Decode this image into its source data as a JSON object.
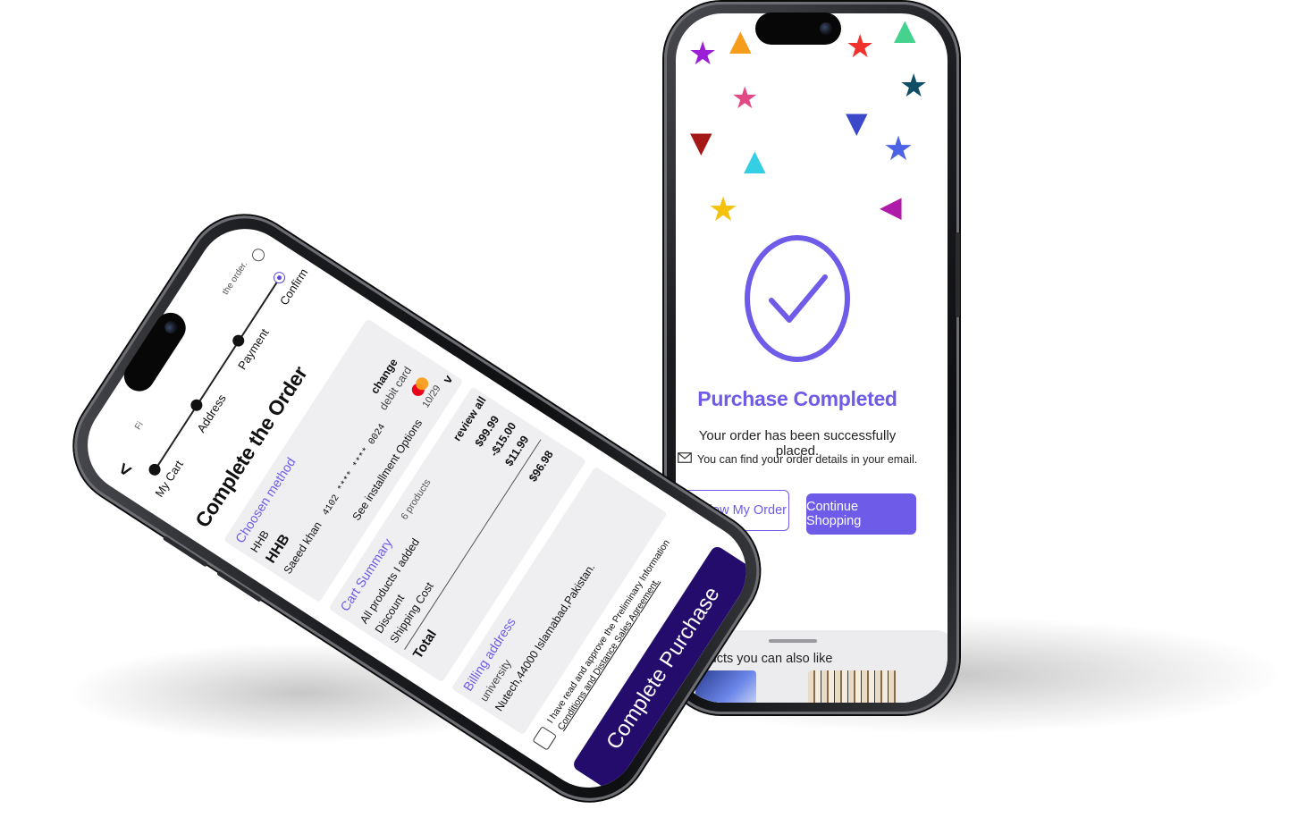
{
  "order_screen": {
    "back_icon": "chevron-left-icon",
    "hint_text": "Fi",
    "hint_text_end": "the order.",
    "steps": [
      "My Cart",
      "Address",
      "Payment",
      "Confirm"
    ],
    "title": "Complete the Order",
    "payment": {
      "section_title": "Choosen method",
      "bank_short": "HHB",
      "bank_name": "HHB",
      "change_label": "change",
      "card_type": "debit card",
      "holder": "Saeed khan",
      "card_number": "4102 **** **** 0024",
      "expiry": "10/29",
      "installments_label": "See installment Options",
      "card_brand_icon": "mastercard-icon"
    },
    "cart": {
      "section_title": "Cart Summary",
      "product_count": "6 products",
      "review_label": "review all",
      "rows": [
        {
          "label": "All products I added",
          "value": "$99.99"
        },
        {
          "label": "Discount",
          "value": "-$15.00"
        },
        {
          "label": "Shipping Cost",
          "value": "$11.99"
        }
      ],
      "total_label": "Total",
      "total_value": "$96.98"
    },
    "billing": {
      "section_title": "Billing address",
      "line1": "university",
      "line2": "Nutech,44000 Islamabad,Pakistan."
    },
    "agreement": {
      "text_line1": "I have read and approve the Preliminary Information",
      "text_line2": "Conditions and Distance Sales Agreement."
    },
    "complete_button": "Complete Purchase"
  },
  "success_screen": {
    "title": "Purchase Completed",
    "message": "Your order has been successfully placed.",
    "email_note": "You can find your order details in your email.",
    "email_icon": "envelope-icon",
    "review_button": "Review My Order",
    "continue_button": "Continue Shopping",
    "recommend_title": "Products you can also like"
  },
  "colors": {
    "accent": "#6e5ce8",
    "complete_button": "#230c6b",
    "panel_gray": "#efeff1"
  }
}
